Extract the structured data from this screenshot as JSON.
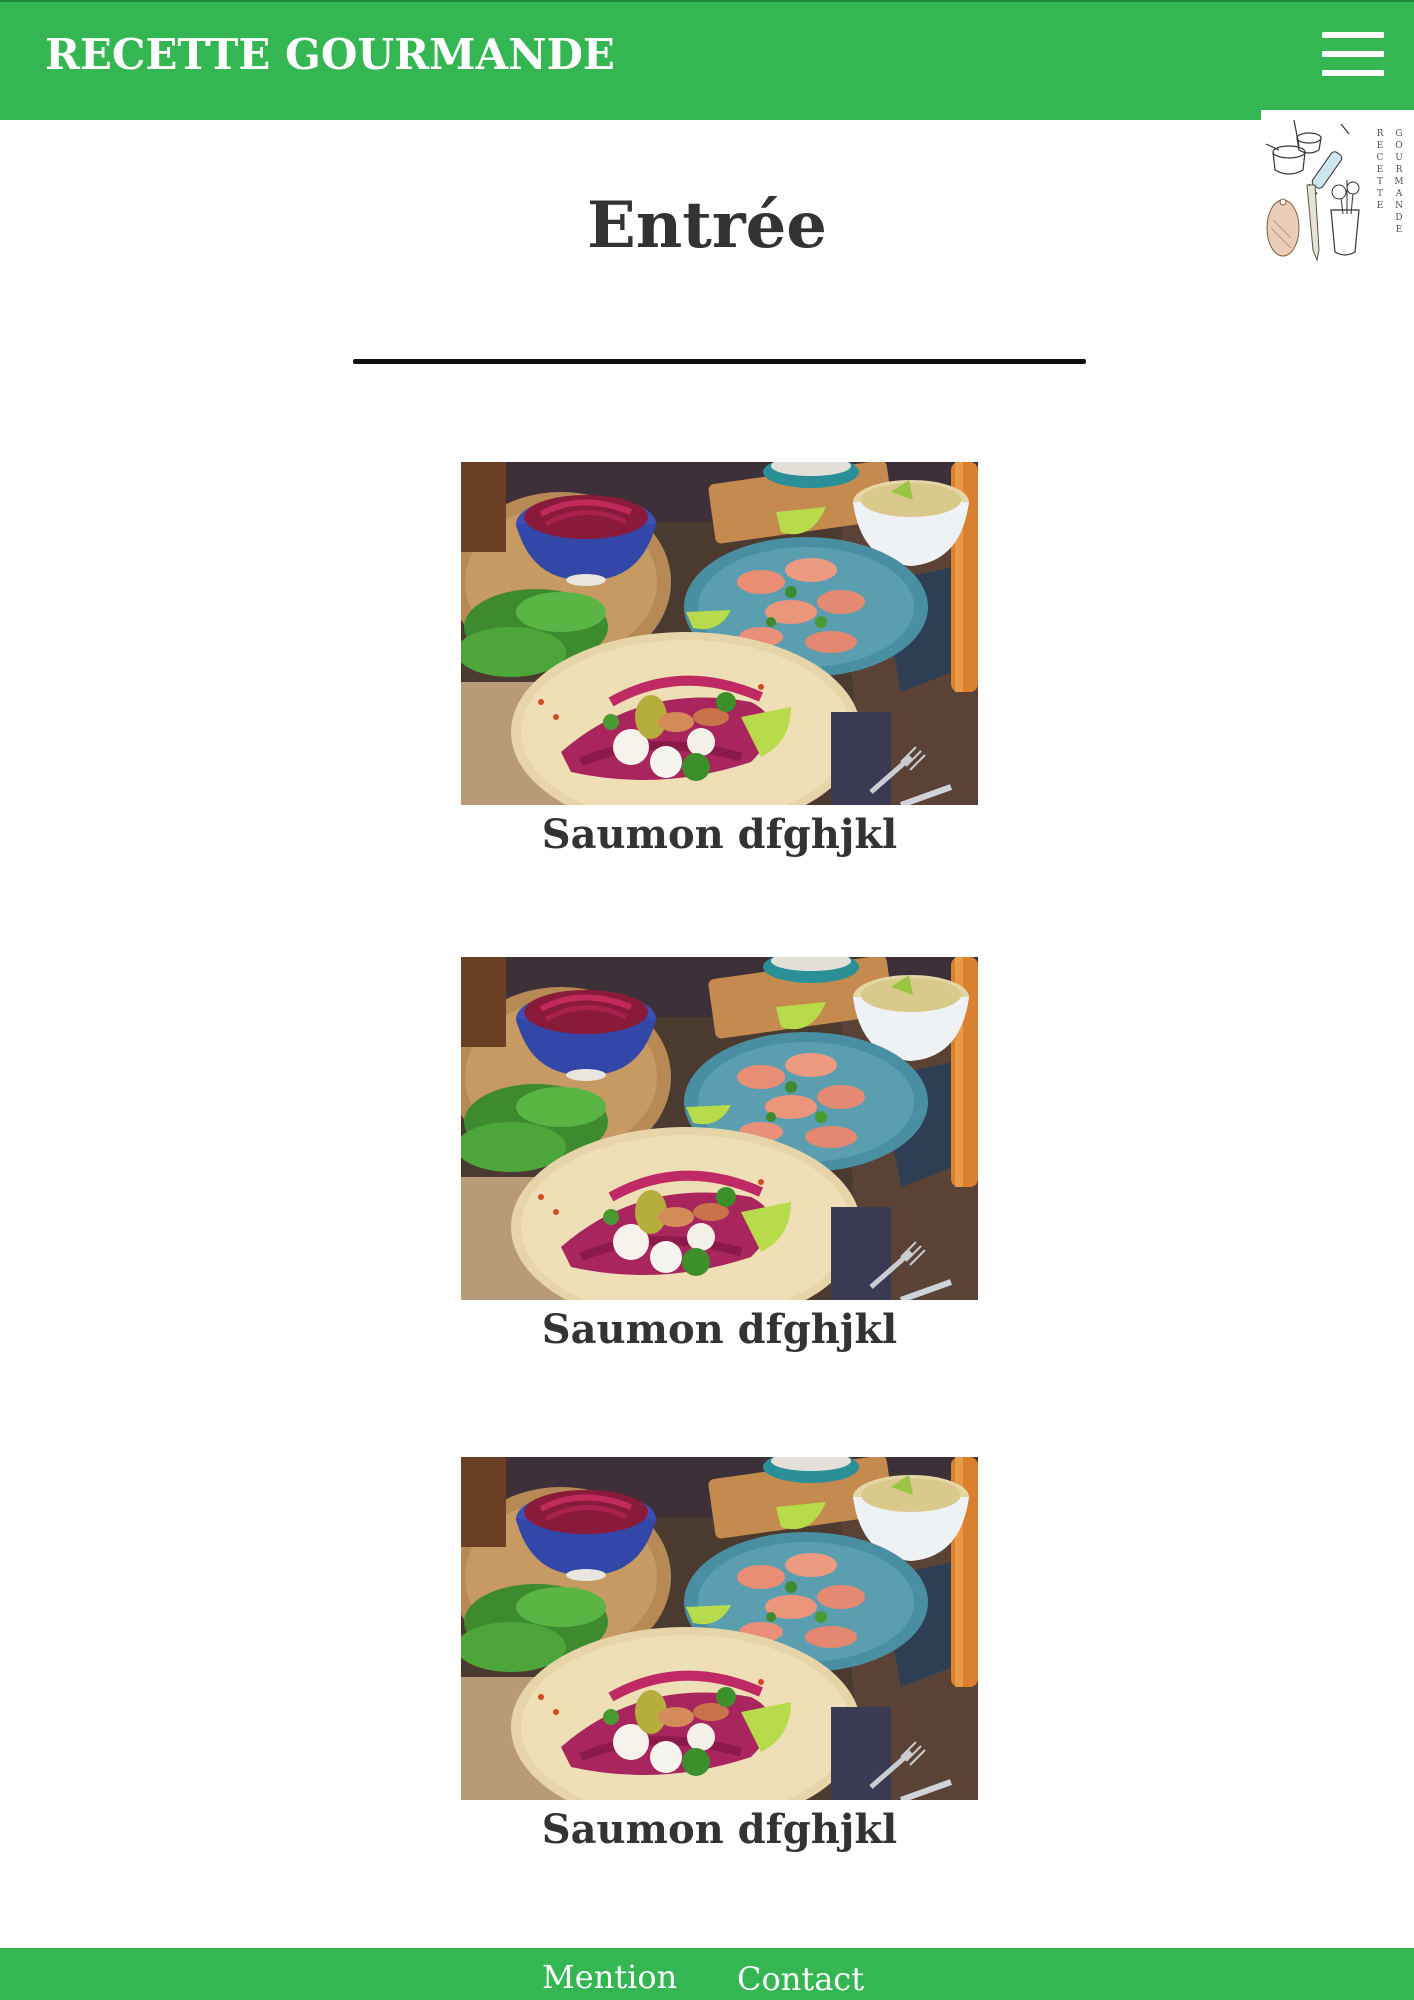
{
  "header": {
    "brand": "RECETTE GOURMANDE",
    "menu_icon": "hamburger-menu-icon",
    "color": "#34b653"
  },
  "logo": {
    "word1": "RECETTE",
    "word2": "GOURMANDE"
  },
  "main": {
    "title": "Entrée",
    "recipes": [
      {
        "title": "Saumon dfghjkl",
        "image": "salmon-tacos-photo"
      },
      {
        "title": "Saumon dfghjkl",
        "image": "salmon-tacos-photo"
      },
      {
        "title": "Saumon dfghjkl",
        "image": "salmon-tacos-photo"
      }
    ]
  },
  "footer": {
    "links": [
      {
        "label": "Mention"
      },
      {
        "label": "Contact"
      }
    ]
  }
}
